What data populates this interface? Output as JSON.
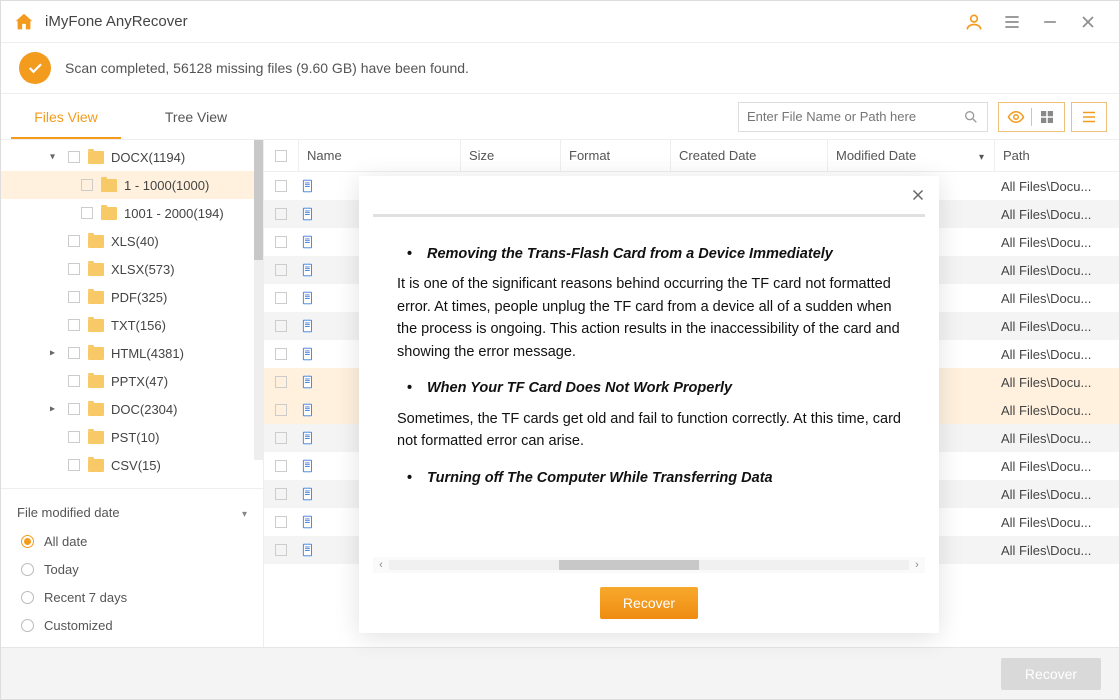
{
  "app_title": "iMyFone AnyRecover",
  "status_text": "Scan completed, 56128 missing files (9.60 GB) have been found.",
  "tabs": {
    "files": "Files View",
    "tree": "Tree View"
  },
  "search_placeholder": "Enter File Name or Path here",
  "columns": {
    "name": "Name",
    "size": "Size",
    "format": "Format",
    "created": "Created Date",
    "modified": "Modified Date",
    "path": "Path"
  },
  "tree": [
    {
      "label": "DOCX(1194)",
      "depth": 0,
      "expandable": true,
      "expanded": true,
      "selected": false
    },
    {
      "label": "1 - 1000(1000)",
      "depth": 1,
      "expandable": false,
      "selected": true
    },
    {
      "label": "1001 - 2000(194)",
      "depth": 1,
      "expandable": false,
      "selected": false
    },
    {
      "label": "XLS(40)",
      "depth": 0,
      "expandable": false,
      "selected": false
    },
    {
      "label": "XLSX(573)",
      "depth": 0,
      "expandable": false,
      "selected": false
    },
    {
      "label": "PDF(325)",
      "depth": 0,
      "expandable": false,
      "selected": false
    },
    {
      "label": "TXT(156)",
      "depth": 0,
      "expandable": false,
      "selected": false
    },
    {
      "label": "HTML(4381)",
      "depth": 0,
      "expandable": true,
      "expanded": false,
      "selected": false
    },
    {
      "label": "PPTX(47)",
      "depth": 0,
      "expandable": false,
      "selected": false
    },
    {
      "label": "DOC(2304)",
      "depth": 0,
      "expandable": true,
      "expanded": false,
      "selected": false
    },
    {
      "label": "PST(10)",
      "depth": 0,
      "expandable": false,
      "selected": false
    },
    {
      "label": "CSV(15)",
      "depth": 0,
      "expandable": false,
      "selected": false
    }
  ],
  "filter": {
    "title": "File modified date",
    "options": [
      "All date",
      "Today",
      "Recent 7 days",
      "Customized"
    ],
    "selected": 0
  },
  "row_path": "All Files\\Docu...",
  "row_count": 14,
  "highlight_rows": [
    7,
    8
  ],
  "footer_recover": "Recover",
  "modal": {
    "bullets": [
      "Removing the Trans-Flash Card from a Device Immediately",
      "When Your TF Card Does Not Work Properly",
      "Turning off The Computer While Transferring Data"
    ],
    "paras": [
      "It is one of the significant reasons behind occurring the TF card not formatted error. At times, people unplug the TF card from a device all of a sudden when the process is ongoing. This action results in the inaccessibility of the card and showing the error message.",
      "Sometimes, the TF cards get old and fail to function correctly. At this time, card not formatted error can arise."
    ],
    "recover": "Recover"
  }
}
